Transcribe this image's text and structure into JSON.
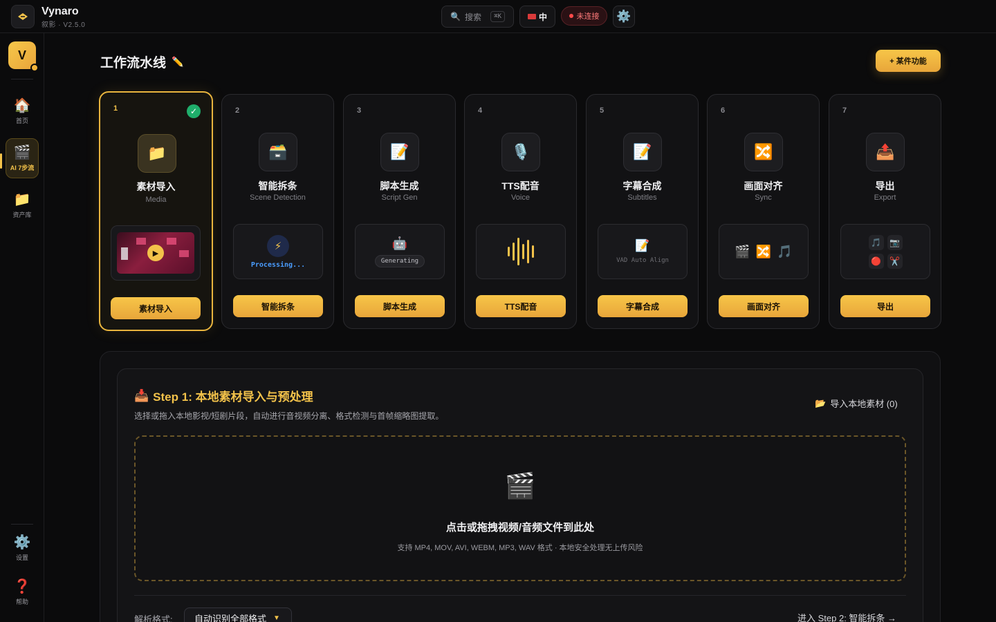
{
  "app": {
    "name": "Vynaro",
    "subtitle": "叙影 · V2.5.0"
  },
  "topbar": {
    "search_placeholder": "搜索",
    "search_shortcut": "⌘K",
    "language": "中",
    "connection_status": "未连接"
  },
  "sidebar": {
    "avatar_letter": "V",
    "items": [
      {
        "label": "首页",
        "icon": "🏠"
      },
      {
        "label": "AI 7步流",
        "icon": "🎬"
      },
      {
        "label": "资产库",
        "icon": "📁"
      },
      {
        "label": "设置",
        "icon": "⚙️"
      },
      {
        "label": "帮助",
        "icon": "❓"
      }
    ]
  },
  "header": {
    "title": "工作流水线",
    "feature_button": "+ 某件功能"
  },
  "steps": [
    {
      "num": "1",
      "title": "素材导入",
      "sub": "Media",
      "icon": "📁",
      "action": "素材导入",
      "completed": true
    },
    {
      "num": "2",
      "title": "智能拆条",
      "sub": "Scene Detection",
      "icon": "🗃️",
      "action": "智能拆条",
      "preview_text": "Processing..."
    },
    {
      "num": "3",
      "title": "脚本生成",
      "sub": "Script Gen",
      "icon": "📝",
      "action": "脚本生成",
      "preview_text": "Generating"
    },
    {
      "num": "4",
      "title": "TTS配音",
      "sub": "Voice",
      "icon": "🎙️",
      "action": "TTS配音"
    },
    {
      "num": "5",
      "title": "字幕合成",
      "sub": "Subtitles",
      "icon": "📝",
      "action": "字幕合成",
      "preview_text": "VAD Auto Align"
    },
    {
      "num": "6",
      "title": "画面对齐",
      "sub": "Sync",
      "icon": "🔀",
      "action": "画面对齐"
    },
    {
      "num": "7",
      "title": "导出",
      "sub": "Export",
      "icon": "📤",
      "action": "导出"
    }
  ],
  "panel": {
    "title": "Step 1: 本地素材导入与预处理",
    "description": "选择或拖入本地影视/短剧片段，自动进行音视频分离、格式检测与首帧缩略图提取。",
    "import_link": "导入本地素材 (0)",
    "dropzone_title": "点击或拖拽视频/音频文件到此处",
    "dropzone_sub": "支持 MP4, MOV, AVI, WEBM, MP3, WAV 格式 · 本地安全处理无上传风险",
    "format_label": "解析格式:",
    "format_value": "自动识别全部格式",
    "next_link": "进入 Step 2: 智能拆条 →"
  },
  "colors": {
    "accent": "#f3c24a",
    "success": "#1fae6b",
    "danger": "#ff4a4a",
    "info": "#4a9cff"
  }
}
